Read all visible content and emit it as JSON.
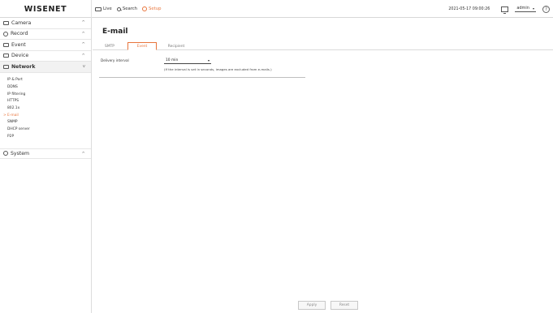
{
  "brand": "WISENET",
  "topnav": {
    "live": "Live",
    "search": "Search",
    "setup": "Setup"
  },
  "topright": {
    "datetime": "2021-05-17 09:00:26",
    "user": "admin"
  },
  "sidebar": {
    "camera": "Camera",
    "record": "Record",
    "event": "Event",
    "device": "Device",
    "network": "Network",
    "system": "System",
    "network_items": [
      "IP & Port",
      "DDNS",
      "IP filtering",
      "HTTPS",
      "802.1x",
      "E-mail",
      "SNMP",
      "DHCP server",
      "P2P"
    ]
  },
  "main": {
    "title": "E-mail",
    "tabs": [
      "SMTP",
      "Event",
      "Recipient"
    ],
    "active_tab": "Event",
    "delivery_interval_label": "Delivery interval",
    "delivery_interval_value": "10 min",
    "note": "(If the interval is set in seconds, images are excluded from e-mails.)",
    "apply_label": "Apply",
    "reset_label": "Reset"
  },
  "colors": {
    "accent": "#e8743b",
    "sidebar_active_bg": "#f2f2f2"
  },
  "icons": [
    "live-icon",
    "search-icon",
    "setup-gear-icon",
    "monitor-icon",
    "help-icon",
    "camera-icon",
    "record-icon",
    "event-icon",
    "device-icon",
    "network-icon",
    "system-icon"
  ]
}
